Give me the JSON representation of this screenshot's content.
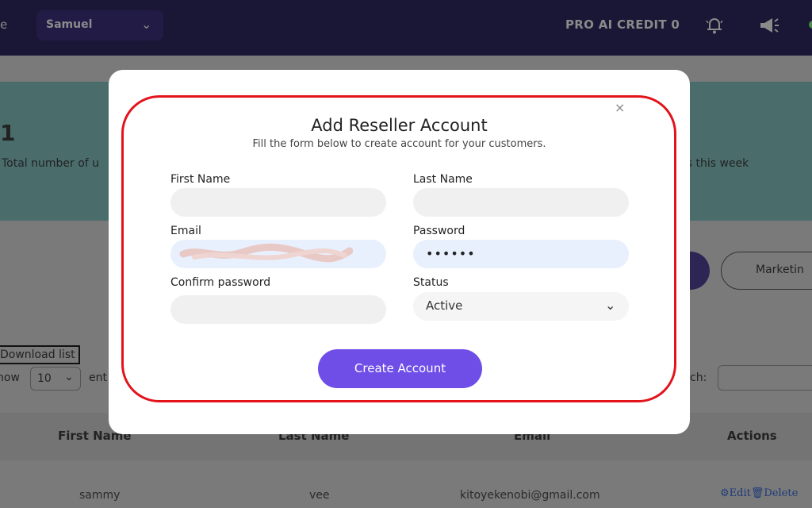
{
  "header": {
    "left_glyph": "e",
    "user_name": "Samuel",
    "credit_label": "PRO AI CREDIT 0",
    "icons": [
      "bell-icon",
      "megaphone-icon",
      "chevron-down-icon"
    ]
  },
  "stats": {
    "count": "1",
    "total_text": "Total number of u",
    "week_text": "rs this week"
  },
  "buttons": {
    "marketing_label": "Marketin"
  },
  "table_controls": {
    "download_label": "Download list",
    "show_label": "how",
    "show_value": "10",
    "entries_label": "ent",
    "search_label": "ch:"
  },
  "table": {
    "headers": [
      "First Name",
      "Last Name",
      "Email",
      "Actions"
    ],
    "rows": [
      {
        "first": "sammy",
        "last": "vee",
        "email": "kitoyekenobi@gmail.com",
        "actions": "Edit",
        "delete": "Delete"
      }
    ]
  },
  "modal": {
    "title": "Add Reseller Account",
    "subtitle": "Fill the form below to create account for your customers.",
    "close_symbol": "×",
    "fields": {
      "first_name_label": "First Name",
      "last_name_label": "Last Name",
      "email_label": "Email",
      "password_label": "Password",
      "password_value": "••••••",
      "confirm_label": "Confirm password",
      "status_label": "Status",
      "status_value": "Active"
    },
    "submit_label": "Create Account"
  },
  "colors": {
    "accent": "#6f4ee8",
    "highlight": "#e3131b",
    "topbar": "#1a1635"
  }
}
